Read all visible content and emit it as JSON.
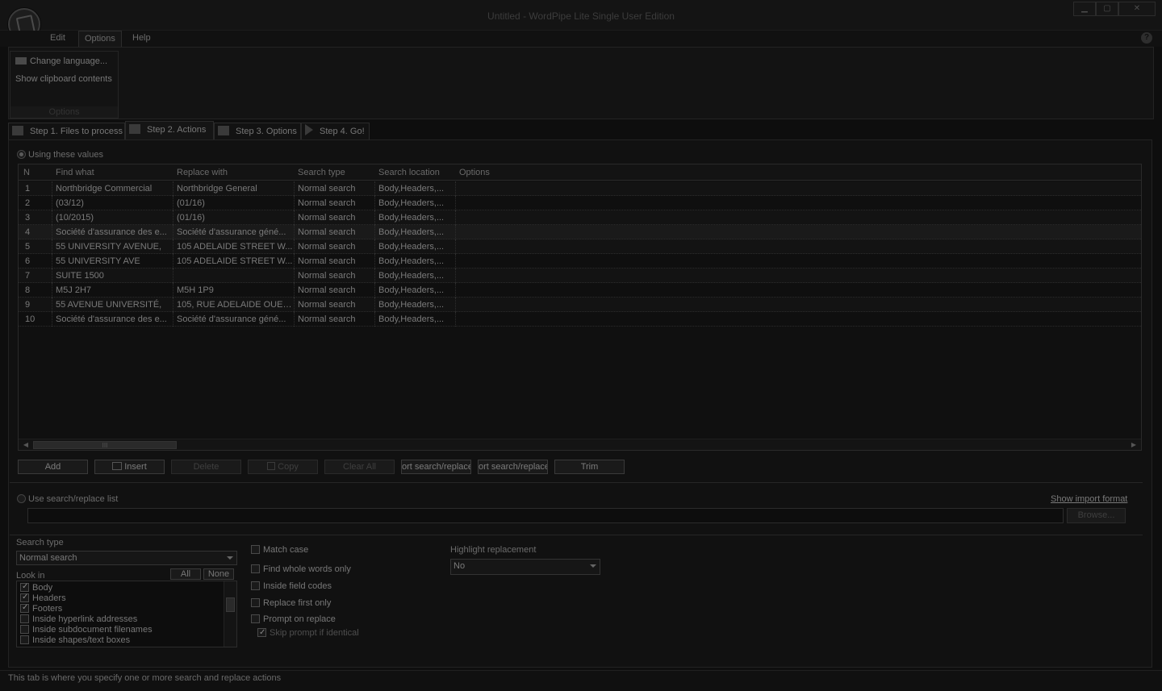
{
  "window": {
    "title": "Untitled - WordPipe Lite Single User Edition",
    "minimize": "▁",
    "maximize": "▢",
    "close": "✕"
  },
  "menu": {
    "items": [
      "Edit",
      "Options",
      "Help"
    ],
    "help_glyph": "?"
  },
  "ribbon": {
    "items": [
      "Change language...",
      "Show clipboard contents"
    ],
    "group_label": "Options"
  },
  "step_tabs": [
    {
      "label": "Step 1. Files to process"
    },
    {
      "label": "Step 2. Actions"
    },
    {
      "label": "Step 3. Options"
    },
    {
      "label": "Step 4. Go!"
    }
  ],
  "actions": {
    "using_values_label": "Using these values",
    "columns": [
      "N",
      "Find what",
      "Replace with",
      "Search type",
      "Search location",
      "Options"
    ],
    "rows": [
      {
        "n": "1",
        "find": "Northbridge Commercial",
        "replace": "Northbridge General",
        "type": "Normal search",
        "location": "Body,Headers,..."
      },
      {
        "n": "2",
        "find": "(03/12)",
        "replace": "(01/16)",
        "type": "Normal search",
        "location": "Body,Headers,..."
      },
      {
        "n": "3",
        "find": "(10/2015)",
        "replace": "(01/16)",
        "type": "Normal search",
        "location": "Body,Headers,..."
      },
      {
        "n": "4",
        "find": "Société d'assurance des e...",
        "replace": "Société d'assurance géné...",
        "type": "Normal search",
        "location": "Body,Headers,..."
      },
      {
        "n": "5",
        "find": "55 UNIVERSITY AVENUE,",
        "replace": "105 ADELAIDE STREET W...",
        "type": "Normal search",
        "location": "Body,Headers,..."
      },
      {
        "n": "6",
        "find": "55 UNIVERSITY AVE",
        "replace": "105 ADELAIDE STREET W...",
        "type": "Normal search",
        "location": "Body,Headers,..."
      },
      {
        "n": "7",
        "find": "SUITE 1500",
        "replace": "",
        "type": "Normal search",
        "location": "Body,Headers,..."
      },
      {
        "n": "8",
        "find": "M5J 2H7",
        "replace": "M5H 1P9",
        "type": "Normal search",
        "location": "Body,Headers,..."
      },
      {
        "n": "9",
        "find": "55 AVENUE UNIVERSITÉ,",
        "replace": "105, RUE ADELAIDE OUEST",
        "type": "Normal search",
        "location": "Body,Headers,..."
      },
      {
        "n": "10",
        "find": "Société d'assurance des e...",
        "replace": "Société d'assurance géné...",
        "type": "Normal search",
        "location": "Body,Headers,..."
      }
    ],
    "scroll_grip": "III",
    "scroll_left": "◀",
    "scroll_right": "▶",
    "buttons": {
      "add": "Add",
      "insert": "Insert",
      "delete": "Delete",
      "copy": "Copy",
      "clear_all": "Clear All",
      "import": "ort search/replace",
      "export": "ort search/replace",
      "trim": "Trim"
    },
    "use_list_label": "Use search/replace list",
    "show_import_format": "Show import format",
    "list_path": "",
    "browse": "Browse..."
  },
  "options": {
    "search_type_label": "Search type",
    "search_type_value": "Normal search",
    "look_in_label": "Look in",
    "all_button": "All",
    "none_button": "None",
    "look_in_items": [
      {
        "label": "Body",
        "checked": true
      },
      {
        "label": "Headers",
        "checked": true
      },
      {
        "label": "Footers",
        "checked": true
      },
      {
        "label": "Inside hyperlink addresses",
        "checked": false
      },
      {
        "label": "Inside subdocument filenames",
        "checked": false
      },
      {
        "label": "Inside shapes/text boxes",
        "checked": false
      }
    ],
    "match_case": "Match case",
    "whole_words": "Find whole words only",
    "field_codes": "Inside field codes",
    "first_only": "Replace first only",
    "prompt": "Prompt on replace",
    "skip_identical": "Skip prompt if identical",
    "highlight_label": "Highlight replacement",
    "highlight_value": "No"
  },
  "status": {
    "text": "This tab is where you specify one or more search and replace actions"
  }
}
